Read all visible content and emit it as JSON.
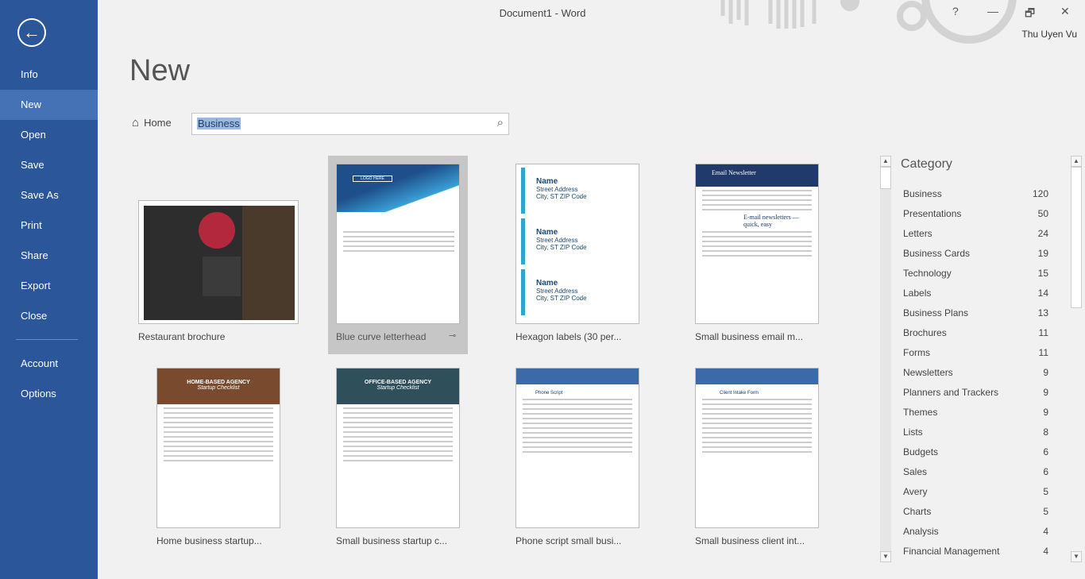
{
  "window": {
    "title": "Document1 - Word",
    "user": "Thu Uyen Vu",
    "help": "?",
    "minimize": "—",
    "restore": "🗗",
    "close": "✕"
  },
  "sidebar": {
    "back": "←",
    "items": [
      {
        "label": "Info"
      },
      {
        "label": "New",
        "selected": true
      },
      {
        "label": "Open"
      },
      {
        "label": "Save"
      },
      {
        "label": "Save As"
      },
      {
        "label": "Print"
      },
      {
        "label": "Share"
      },
      {
        "label": "Export"
      },
      {
        "label": "Close"
      },
      {
        "label": "Account"
      },
      {
        "label": "Options"
      }
    ]
  },
  "main": {
    "title": "New",
    "home_label": "Home",
    "search": {
      "value": "Business"
    }
  },
  "templates": [
    {
      "label": "Restaurant brochure"
    },
    {
      "label": "Blue curve letterhead",
      "selected": true,
      "thumb_text": "LOGO HERE"
    },
    {
      "label": "Hexagon labels (30 per...",
      "thumb_name": "Name",
      "thumb_addr1": "Street Address",
      "thumb_addr2": "City, ST ZIP Code"
    },
    {
      "label": "Small business email m...",
      "thumb_title": "Email Newsletter",
      "thumb_sub": "E-mail newsletters — quick, easy"
    },
    {
      "label": "Home business startup...",
      "thumb_title": "HOME-BASED AGENCY",
      "thumb_sub": "Startup Checklist"
    },
    {
      "label": "Small business startup c...",
      "thumb_title": "OFFICE-BASED AGENCY",
      "thumb_sub": "Startup Checklist"
    },
    {
      "label": "Phone script small busi...",
      "thumb_title": "Phone Script"
    },
    {
      "label": "Small business client int...",
      "thumb_title": "Client Intake Form"
    }
  ],
  "category": {
    "heading": "Category",
    "items": [
      {
        "label": "Business",
        "count": "120"
      },
      {
        "label": "Presentations",
        "count": "50"
      },
      {
        "label": "Letters",
        "count": "24"
      },
      {
        "label": "Business Cards",
        "count": "19"
      },
      {
        "label": "Technology",
        "count": "15"
      },
      {
        "label": "Labels",
        "count": "14"
      },
      {
        "label": "Business Plans",
        "count": "13"
      },
      {
        "label": "Brochures",
        "count": "11"
      },
      {
        "label": "Forms",
        "count": "11"
      },
      {
        "label": "Newsletters",
        "count": "9"
      },
      {
        "label": "Planners and Trackers",
        "count": "9"
      },
      {
        "label": "Themes",
        "count": "9"
      },
      {
        "label": "Lists",
        "count": "8"
      },
      {
        "label": "Budgets",
        "count": "6"
      },
      {
        "label": "Sales",
        "count": "6"
      },
      {
        "label": "Avery",
        "count": "5"
      },
      {
        "label": "Charts",
        "count": "5"
      },
      {
        "label": "Analysis",
        "count": "4"
      },
      {
        "label": "Financial Management",
        "count": "4"
      }
    ]
  },
  "colors": {
    "sidebar": "#2b579a",
    "sidebar_selected": "#4472b4",
    "selection": "#9ab8e0"
  }
}
